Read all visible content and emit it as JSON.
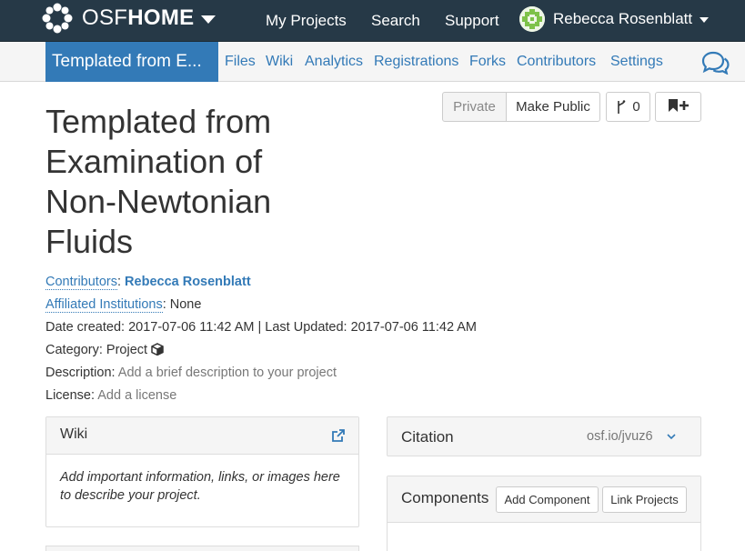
{
  "topbar": {
    "brand_thin": "OSF",
    "brand_bold": "HOME",
    "nav": [
      "My Projects",
      "Search",
      "Support"
    ],
    "user_name": "Rebecca Rosenblatt"
  },
  "subnav": {
    "project_tab": "Templated from E...",
    "links": [
      "Files",
      "Wiki",
      "Analytics",
      "Registrations",
      "Forks",
      "Contributors",
      "Settings"
    ]
  },
  "actions": {
    "private_label": "Private",
    "make_public_label": "Make Public",
    "fork_count": "0"
  },
  "project": {
    "title": "Templated from Examination of Non-Newtonian Fluids",
    "contributors_label": "Contributors",
    "contributor_name": "Rebecca Rosenblatt",
    "affiliated_label": "Affiliated Institutions",
    "affiliated_value": "None",
    "dates": "Date created: 2017-07-06 11:42 AM | Last Updated: 2017-07-06 11:42 AM",
    "category_label": "Category:",
    "category_value": "Project",
    "description_label": "Description:",
    "description_value": "Add a brief description to your project",
    "license_label": "License:",
    "license_value": "Add a license"
  },
  "wiki_panel": {
    "title": "Wiki",
    "body": "Add important information, links, or images here to describe your project."
  },
  "citation_panel": {
    "title": "Citation",
    "url": "osf.io/jvuz6"
  },
  "components_panel": {
    "title": "Components",
    "add_label": "Add Component",
    "link_label": "Link Projects"
  },
  "colors": {
    "navbar": "#263947",
    "accent": "#337ab7"
  }
}
